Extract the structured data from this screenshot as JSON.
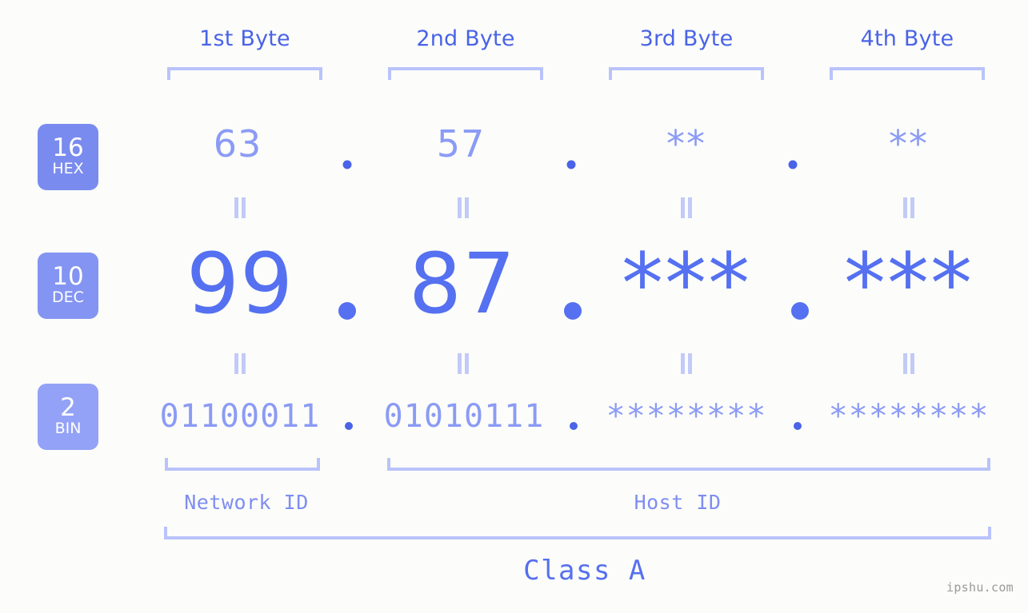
{
  "meta": {
    "watermark": "ipshu.com",
    "background_color": "#fcfdfa",
    "accent_color": "#5570f0",
    "accent_light_color": "#8b9bf5",
    "bracket_color": "#b9c3fb"
  },
  "byte_headers": [
    {
      "label": "1st Byte"
    },
    {
      "label": "2nd Byte"
    },
    {
      "label": "3rd Byte"
    },
    {
      "label": "4th Byte"
    }
  ],
  "radix_badges": [
    {
      "number": "16",
      "system": "HEX",
      "color": "#7a8bef"
    },
    {
      "number": "10",
      "system": "DEC",
      "color": "#8494f2"
    },
    {
      "number": "2",
      "system": "BIN",
      "color": "#93a2f6"
    }
  ],
  "rows": {
    "hex": {
      "radix": "16",
      "system": "HEX",
      "values": [
        "63",
        "57",
        "**",
        "**"
      ],
      "separator": "."
    },
    "dec": {
      "radix": "10",
      "system": "DEC",
      "values": [
        "99",
        "87",
        "***",
        "***"
      ],
      "separator": "."
    },
    "bin": {
      "radix": "2",
      "system": "BIN",
      "values": [
        "01100011",
        "01010111",
        "********",
        "********"
      ],
      "separator": "."
    }
  },
  "equality_marks": {
    "symbol": "=",
    "count_per_row": 4
  },
  "sections": {
    "network_id": "Network ID",
    "host_id": "Host ID",
    "class": "Class A"
  }
}
